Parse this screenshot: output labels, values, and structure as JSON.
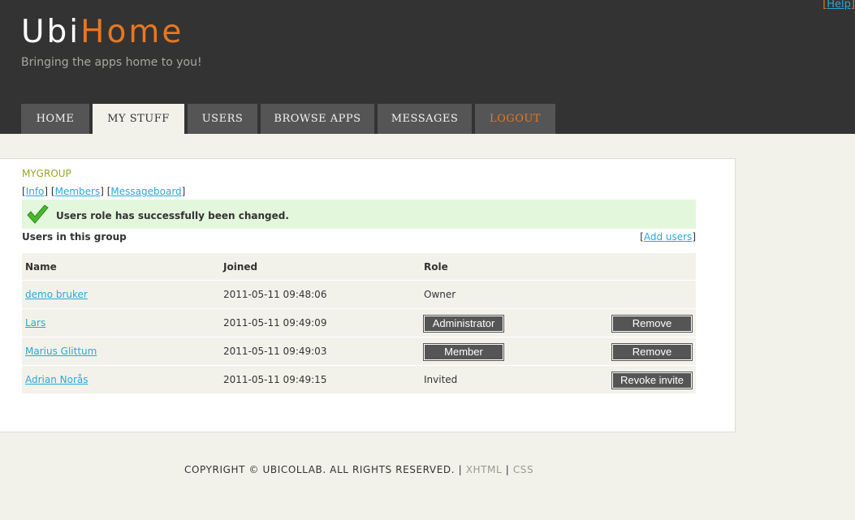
{
  "header": {
    "help_label": "Help",
    "logo_part1": "Ubi",
    "logo_part2": "Home",
    "tagline": "Bringing the apps home to you!"
  },
  "nav": {
    "tabs": [
      {
        "label": "HOME"
      },
      {
        "label": "MY STUFF",
        "active": true
      },
      {
        "label": "USERS"
      },
      {
        "label": "BROWSE APPS"
      },
      {
        "label": "MESSAGES"
      },
      {
        "label": "LOGOUT"
      }
    ]
  },
  "group": {
    "title": "MYGROUP",
    "links": [
      "Info",
      "Members",
      "Messageboard"
    ],
    "success_message": "Users role has successfully been changed.",
    "users_heading": "Users in this group",
    "add_users_label": "Add users"
  },
  "table": {
    "columns": [
      "Name",
      "Joined",
      "Role"
    ],
    "rows": [
      {
        "name": "demo bruker",
        "joined": "2011-05-11 09:48:06",
        "role": "Owner",
        "role_is_button": false,
        "action": ""
      },
      {
        "name": "Lars",
        "joined": "2011-05-11 09:49:09",
        "role": "Administrator",
        "role_is_button": true,
        "action": "Remove"
      },
      {
        "name": "Marius Glittum",
        "joined": "2011-05-11 09:49:03",
        "role": "Member",
        "role_is_button": true,
        "action": "Remove"
      },
      {
        "name": "Adrian Norås",
        "joined": "2011-05-11 09:49:15",
        "role": "Invited",
        "role_is_button": false,
        "action": "Revoke invite"
      }
    ]
  },
  "footer": {
    "copyright": "COPYRIGHT © UBICOLLAB. ALL RIGHTS RESERVED.",
    "sep": "|",
    "xhtml": "XHTML",
    "css": "CSS"
  },
  "colors": {
    "header_bg": "#333333",
    "accent_orange": "#e8771e",
    "link_blue": "#29a8d8",
    "group_title_green": "#99a61f",
    "success_bg": "#e3f7dc"
  }
}
